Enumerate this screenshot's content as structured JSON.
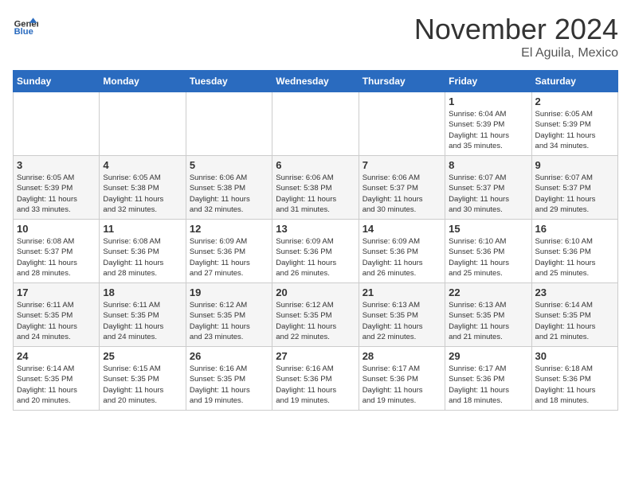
{
  "logo": {
    "text_general": "General",
    "text_blue": "Blue"
  },
  "header": {
    "month": "November 2024",
    "location": "El Aguila, Mexico"
  },
  "weekdays": [
    "Sunday",
    "Monday",
    "Tuesday",
    "Wednesday",
    "Thursday",
    "Friday",
    "Saturday"
  ],
  "weeks": [
    [
      {
        "day": "",
        "info": ""
      },
      {
        "day": "",
        "info": ""
      },
      {
        "day": "",
        "info": ""
      },
      {
        "day": "",
        "info": ""
      },
      {
        "day": "",
        "info": ""
      },
      {
        "day": "1",
        "info": "Sunrise: 6:04 AM\nSunset: 5:39 PM\nDaylight: 11 hours\nand 35 minutes."
      },
      {
        "day": "2",
        "info": "Sunrise: 6:05 AM\nSunset: 5:39 PM\nDaylight: 11 hours\nand 34 minutes."
      }
    ],
    [
      {
        "day": "3",
        "info": "Sunrise: 6:05 AM\nSunset: 5:39 PM\nDaylight: 11 hours\nand 33 minutes."
      },
      {
        "day": "4",
        "info": "Sunrise: 6:05 AM\nSunset: 5:38 PM\nDaylight: 11 hours\nand 32 minutes."
      },
      {
        "day": "5",
        "info": "Sunrise: 6:06 AM\nSunset: 5:38 PM\nDaylight: 11 hours\nand 32 minutes."
      },
      {
        "day": "6",
        "info": "Sunrise: 6:06 AM\nSunset: 5:38 PM\nDaylight: 11 hours\nand 31 minutes."
      },
      {
        "day": "7",
        "info": "Sunrise: 6:06 AM\nSunset: 5:37 PM\nDaylight: 11 hours\nand 30 minutes."
      },
      {
        "day": "8",
        "info": "Sunrise: 6:07 AM\nSunset: 5:37 PM\nDaylight: 11 hours\nand 30 minutes."
      },
      {
        "day": "9",
        "info": "Sunrise: 6:07 AM\nSunset: 5:37 PM\nDaylight: 11 hours\nand 29 minutes."
      }
    ],
    [
      {
        "day": "10",
        "info": "Sunrise: 6:08 AM\nSunset: 5:37 PM\nDaylight: 11 hours\nand 28 minutes."
      },
      {
        "day": "11",
        "info": "Sunrise: 6:08 AM\nSunset: 5:36 PM\nDaylight: 11 hours\nand 28 minutes."
      },
      {
        "day": "12",
        "info": "Sunrise: 6:09 AM\nSunset: 5:36 PM\nDaylight: 11 hours\nand 27 minutes."
      },
      {
        "day": "13",
        "info": "Sunrise: 6:09 AM\nSunset: 5:36 PM\nDaylight: 11 hours\nand 26 minutes."
      },
      {
        "day": "14",
        "info": "Sunrise: 6:09 AM\nSunset: 5:36 PM\nDaylight: 11 hours\nand 26 minutes."
      },
      {
        "day": "15",
        "info": "Sunrise: 6:10 AM\nSunset: 5:36 PM\nDaylight: 11 hours\nand 25 minutes."
      },
      {
        "day": "16",
        "info": "Sunrise: 6:10 AM\nSunset: 5:36 PM\nDaylight: 11 hours\nand 25 minutes."
      }
    ],
    [
      {
        "day": "17",
        "info": "Sunrise: 6:11 AM\nSunset: 5:35 PM\nDaylight: 11 hours\nand 24 minutes."
      },
      {
        "day": "18",
        "info": "Sunrise: 6:11 AM\nSunset: 5:35 PM\nDaylight: 11 hours\nand 24 minutes."
      },
      {
        "day": "19",
        "info": "Sunrise: 6:12 AM\nSunset: 5:35 PM\nDaylight: 11 hours\nand 23 minutes."
      },
      {
        "day": "20",
        "info": "Sunrise: 6:12 AM\nSunset: 5:35 PM\nDaylight: 11 hours\nand 22 minutes."
      },
      {
        "day": "21",
        "info": "Sunrise: 6:13 AM\nSunset: 5:35 PM\nDaylight: 11 hours\nand 22 minutes."
      },
      {
        "day": "22",
        "info": "Sunrise: 6:13 AM\nSunset: 5:35 PM\nDaylight: 11 hours\nand 21 minutes."
      },
      {
        "day": "23",
        "info": "Sunrise: 6:14 AM\nSunset: 5:35 PM\nDaylight: 11 hours\nand 21 minutes."
      }
    ],
    [
      {
        "day": "24",
        "info": "Sunrise: 6:14 AM\nSunset: 5:35 PM\nDaylight: 11 hours\nand 20 minutes."
      },
      {
        "day": "25",
        "info": "Sunrise: 6:15 AM\nSunset: 5:35 PM\nDaylight: 11 hours\nand 20 minutes."
      },
      {
        "day": "26",
        "info": "Sunrise: 6:16 AM\nSunset: 5:35 PM\nDaylight: 11 hours\nand 19 minutes."
      },
      {
        "day": "27",
        "info": "Sunrise: 6:16 AM\nSunset: 5:36 PM\nDaylight: 11 hours\nand 19 minutes."
      },
      {
        "day": "28",
        "info": "Sunrise: 6:17 AM\nSunset: 5:36 PM\nDaylight: 11 hours\nand 19 minutes."
      },
      {
        "day": "29",
        "info": "Sunrise: 6:17 AM\nSunset: 5:36 PM\nDaylight: 11 hours\nand 18 minutes."
      },
      {
        "day": "30",
        "info": "Sunrise: 6:18 AM\nSunset: 5:36 PM\nDaylight: 11 hours\nand 18 minutes."
      }
    ]
  ]
}
